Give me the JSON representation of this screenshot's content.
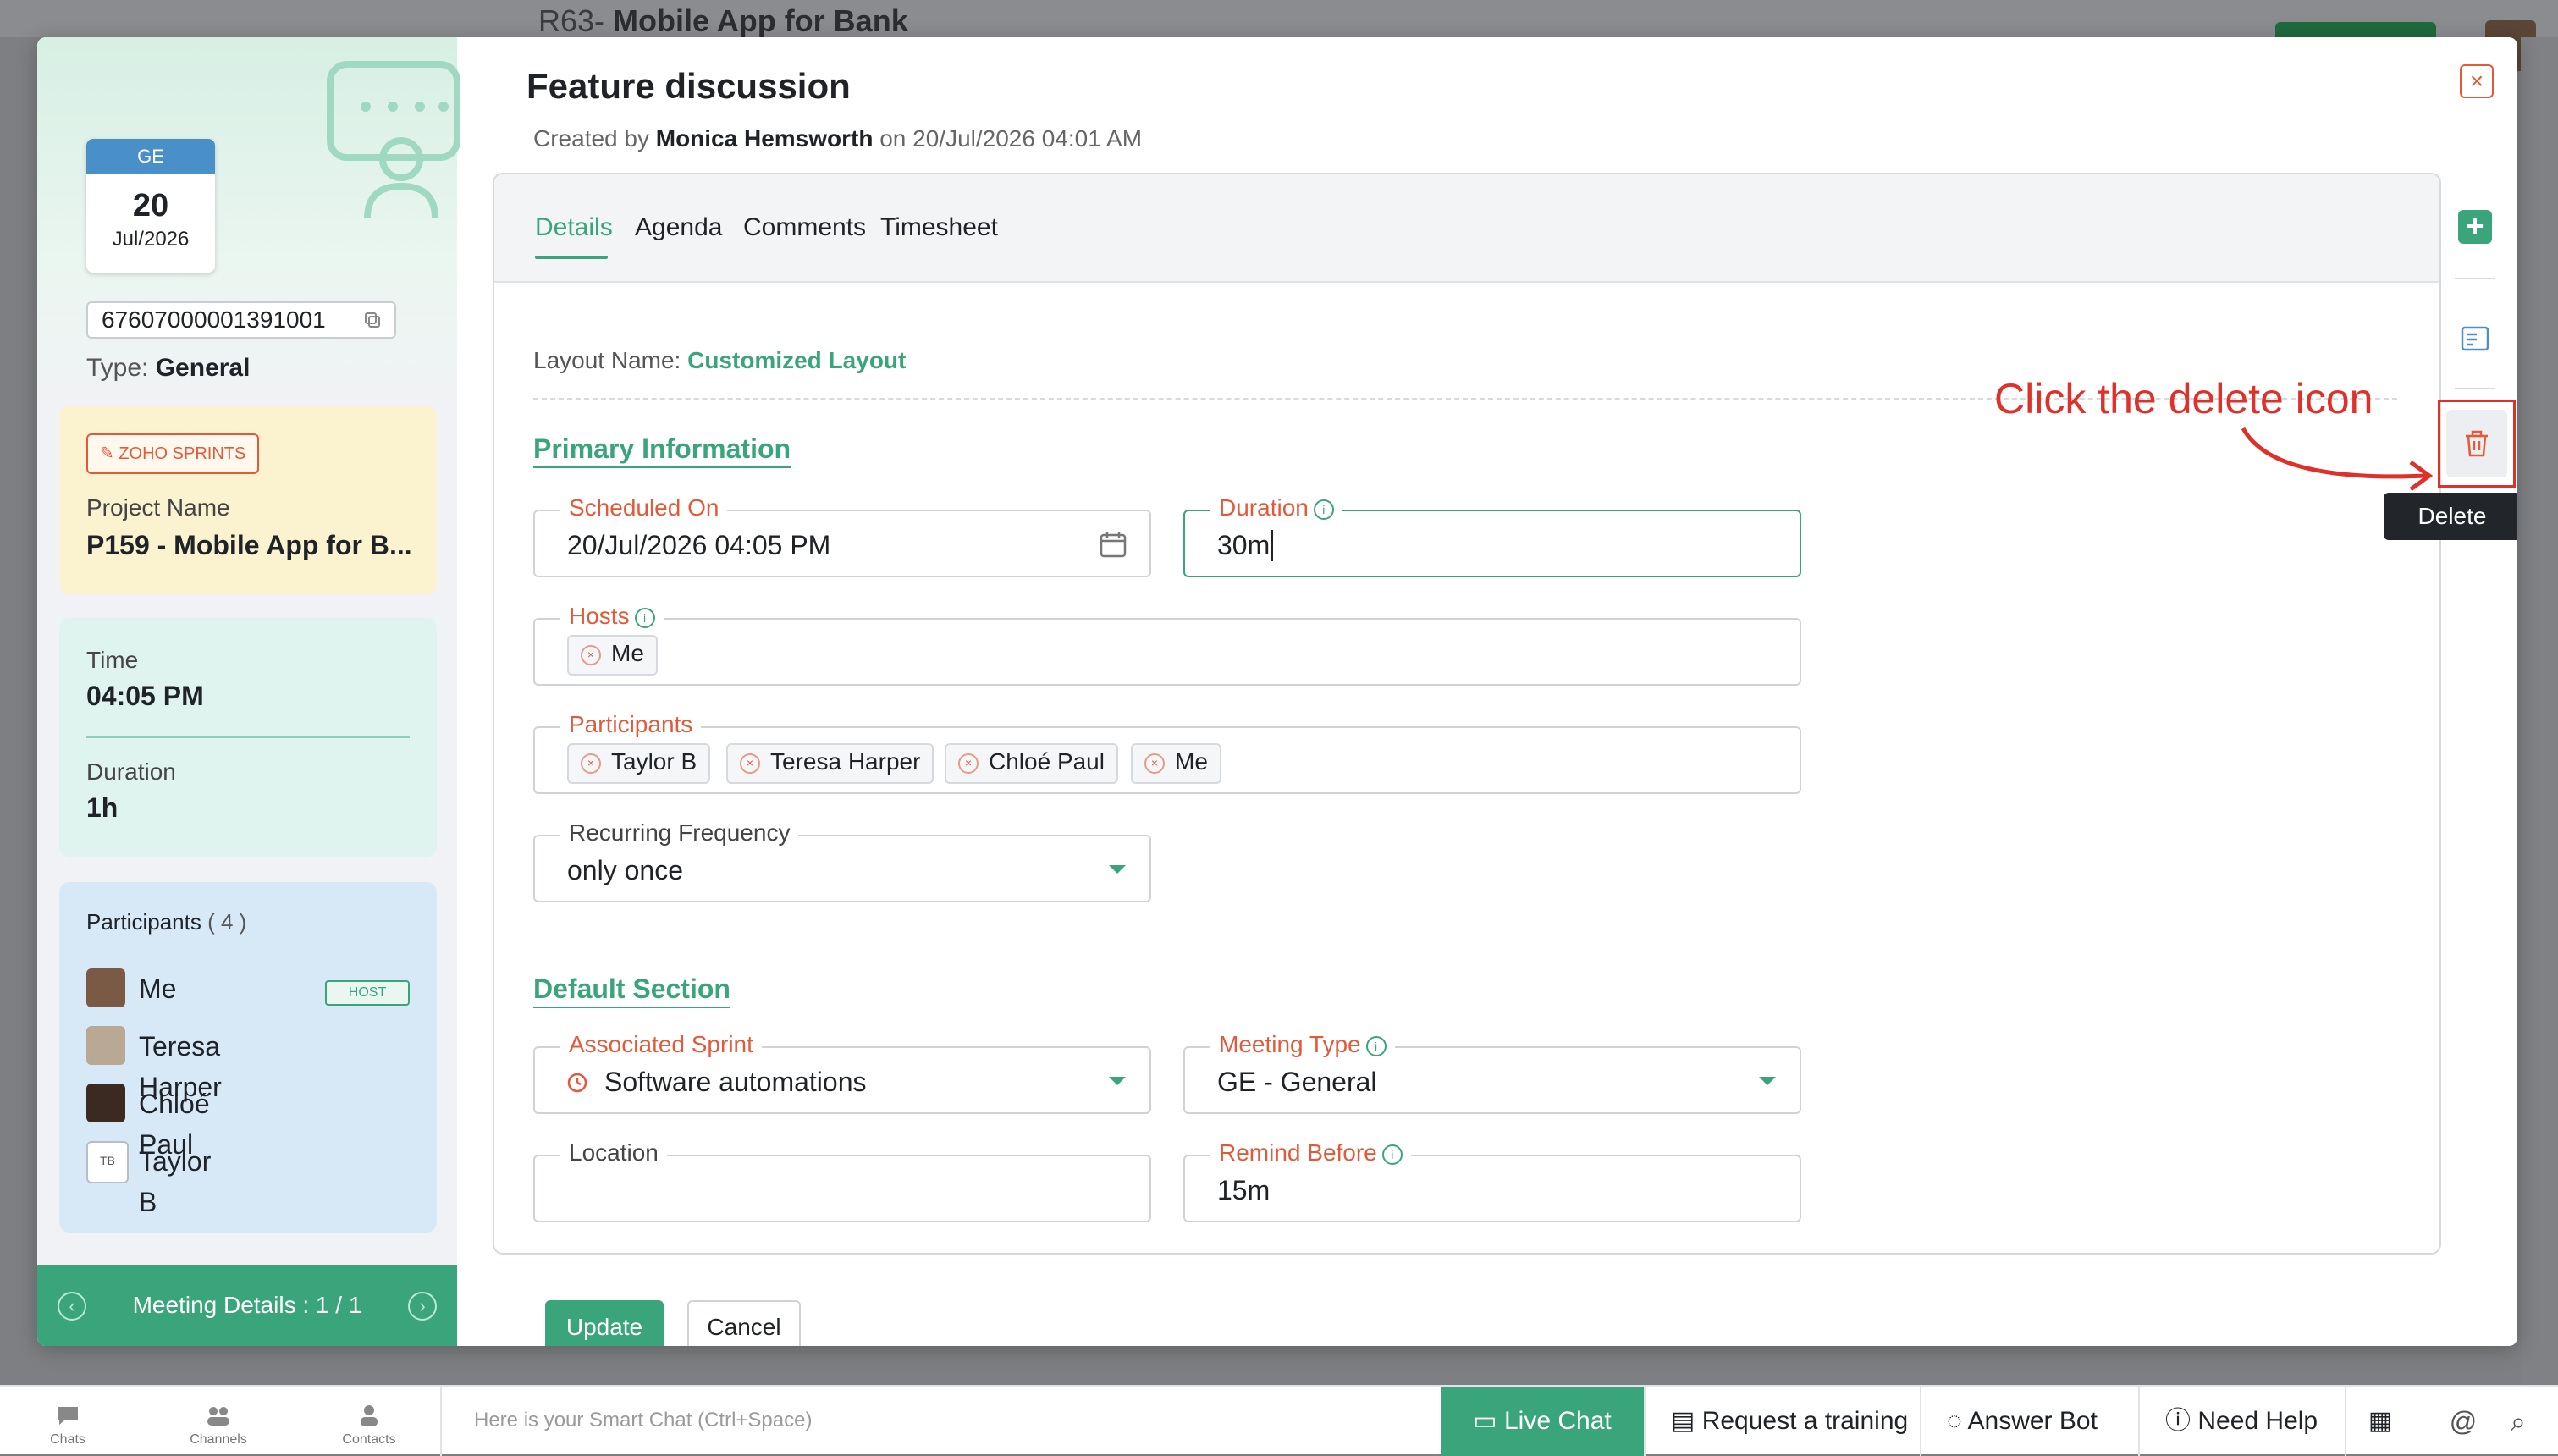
{
  "background": {
    "page_title_prefix": "R63-",
    "page_title": "Mobile App for Bank"
  },
  "left_panel": {
    "calendar": {
      "code": "GE",
      "day": "20",
      "month_year": "Jul/2026"
    },
    "meeting_id": "67607000001391001",
    "type_label": "Type:",
    "type_value": "General",
    "badge": "ZOHO SPRINTS",
    "project_label": "Project Name",
    "project_value": "P159 - Mobile App for B...",
    "time_label": "Time",
    "time_value": "04:05 PM",
    "duration_label": "Duration",
    "duration_value": "1h",
    "participants_title": "Participants",
    "participants_count": "( 4 )",
    "participants": [
      {
        "name": "Me",
        "badge": "HOST"
      },
      {
        "name": "Teresa Harper"
      },
      {
        "name": "Chloé Paul"
      },
      {
        "name": "Taylor B",
        "initials": "TB"
      }
    ],
    "footer": "Meeting Details : 1 / 1"
  },
  "header": {
    "title": "Feature discussion",
    "created_by_prefix": "Created by",
    "created_by_name": "Monica Hemsworth",
    "created_on": "on 20/Jul/2026 04:01 AM"
  },
  "tabs": [
    "Details",
    "Agenda",
    "Comments",
    "Timesheet"
  ],
  "form": {
    "layout_label": "Layout Name:",
    "layout_value": "Customized Layout",
    "primary_section": "Primary Information",
    "scheduled_on_label": "Scheduled On",
    "scheduled_on_value": "20/Jul/2026 04:05 PM",
    "duration_label": "Duration",
    "duration_value": "30m",
    "hosts_label": "Hosts",
    "hosts": [
      "Me"
    ],
    "participants_label": "Participants",
    "participants": [
      "Taylor B",
      "Teresa Harper",
      "Chloé Paul",
      "Me"
    ],
    "recurring_label": "Recurring Frequency",
    "recurring_value": "only once",
    "default_section": "Default Section",
    "sprint_label": "Associated Sprint",
    "sprint_value": "Software automations",
    "meeting_type_label": "Meeting Type",
    "meeting_type_value": "GE - General",
    "location_label": "Location",
    "location_value": "",
    "remind_label": "Remind Before",
    "remind_value": "15m"
  },
  "actions": {
    "update": "Update",
    "cancel": "Cancel"
  },
  "toolbar": {
    "delete_tooltip": "Delete"
  },
  "annotation": "Click the delete icon",
  "bottom_bar": {
    "chats": "Chats",
    "channels": "Channels",
    "contacts": "Contacts",
    "smart_chat_placeholder": "Here is your Smart Chat (Ctrl+Space)",
    "live_chat": "Live Chat",
    "request_training": "Request a training",
    "answer_bot": "Answer Bot",
    "need_help": "Need Help"
  },
  "colors": {
    "accent": "#3aa57a",
    "required": "#e25a3a",
    "annotation": "#e0302a"
  }
}
